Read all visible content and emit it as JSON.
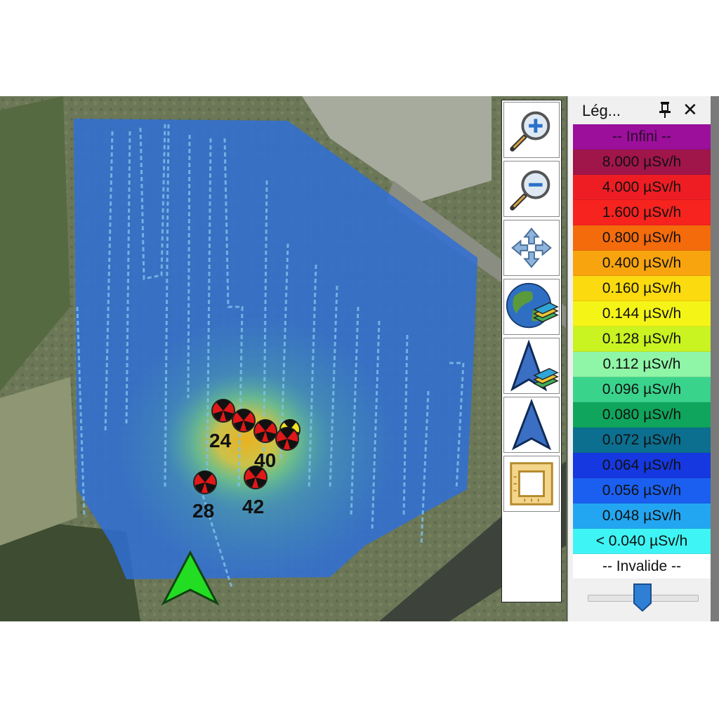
{
  "legend": {
    "title": "Lég...",
    "pin_icon": "pin-icon",
    "close_label": "✕",
    "rows": [
      {
        "label": "-- Infini --",
        "color": "#9b0f9b",
        "text_color": "#2a0a2a"
      },
      {
        "label": "8.000 µSv/h",
        "color": "#a0154a",
        "text_color": "#111111"
      },
      {
        "label": "4.000 µSv/h",
        "color": "#ee1d24",
        "text_color": "#111111"
      },
      {
        "label": "1.600 µSv/h",
        "color": "#f7231f",
        "text_color": "#111111"
      },
      {
        "label": "0.800 µSv/h",
        "color": "#f46b0c",
        "text_color": "#111111"
      },
      {
        "label": "0.400 µSv/h",
        "color": "#f8a40f",
        "text_color": "#111111"
      },
      {
        "label": "0.160 µSv/h",
        "color": "#fbdb10",
        "text_color": "#111111"
      },
      {
        "label": "0.144 µSv/h",
        "color": "#f5f417",
        "text_color": "#111111"
      },
      {
        "label": "0.128 µSv/h",
        "color": "#c9f321",
        "text_color": "#111111"
      },
      {
        "label": "0.112 µSv/h",
        "color": "#8ff5a7",
        "text_color": "#111111"
      },
      {
        "label": "0.096 µSv/h",
        "color": "#3ad38c",
        "text_color": "#111111"
      },
      {
        "label": "0.080 µSv/h",
        "color": "#10a55c",
        "text_color": "#111111"
      },
      {
        "label": "0.072 µSv/h",
        "color": "#0c6f8f",
        "text_color": "#111111"
      },
      {
        "label": "0.064 µSv/h",
        "color": "#1538e0",
        "text_color": "#111111"
      },
      {
        "label": "0.056 µSv/h",
        "color": "#1a5ff0",
        "text_color": "#111111"
      },
      {
        "label": "0.048 µSv/h",
        "color": "#23a6f1",
        "text_color": "#111111"
      },
      {
        "label": "< 0.040 µSv/h",
        "color": "#3ff4f4",
        "text_color": "#111111"
      },
      {
        "label": "-- Invalide --",
        "color": "#ffffff",
        "text_color": "#111111"
      }
    ],
    "opacity_slider_value": 0.5
  },
  "toolbar": {
    "buttons": [
      {
        "name": "zoom-in",
        "icon": "zoom-in-icon"
      },
      {
        "name": "zoom-out",
        "icon": "zoom-out-icon"
      },
      {
        "name": "pan",
        "icon": "pan-arrows-icon"
      },
      {
        "name": "globe-layers",
        "icon": "globe-layers-icon"
      },
      {
        "name": "navigation-layers",
        "icon": "navigation-arrow-layers-icon"
      },
      {
        "name": "navigation",
        "icon": "navigation-arrow-icon"
      },
      {
        "name": "map-extent",
        "icon": "map-frame-icon"
      }
    ]
  },
  "map": {
    "sources": [
      {
        "label": "24"
      },
      {
        "label": "40"
      },
      {
        "label": "28"
      },
      {
        "label": "42"
      }
    ],
    "position_marker": "green-navigation-arrow-icon"
  }
}
